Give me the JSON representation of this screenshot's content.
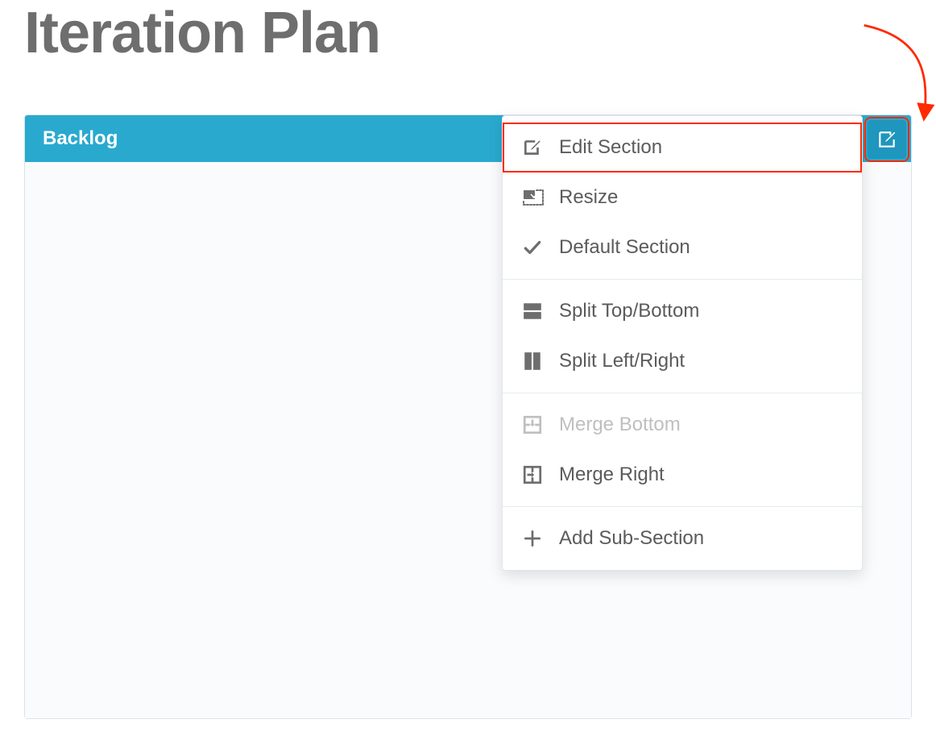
{
  "page": {
    "title": "Iteration Plan"
  },
  "panel": {
    "title": "Backlog"
  },
  "menu": {
    "groups": [
      {
        "items": [
          {
            "id": "edit-section",
            "label": "Edit Section",
            "icon": "edit-icon",
            "highlighted": true,
            "disabled": false
          },
          {
            "id": "resize",
            "label": "Resize",
            "icon": "resize-icon",
            "highlighted": false,
            "disabled": false
          },
          {
            "id": "default-section",
            "label": "Default Section",
            "icon": "check-icon",
            "highlighted": false,
            "disabled": false
          }
        ]
      },
      {
        "items": [
          {
            "id": "split-top-bottom",
            "label": "Split Top/Bottom",
            "icon": "split-horizontal-icon",
            "highlighted": false,
            "disabled": false
          },
          {
            "id": "split-left-right",
            "label": "Split Left/Right",
            "icon": "split-vertical-icon",
            "highlighted": false,
            "disabled": false
          }
        ]
      },
      {
        "items": [
          {
            "id": "merge-bottom",
            "label": "Merge Bottom",
            "icon": "merge-bottom-icon",
            "highlighted": false,
            "disabled": true
          },
          {
            "id": "merge-right",
            "label": "Merge Right",
            "icon": "merge-right-icon",
            "highlighted": false,
            "disabled": false
          }
        ]
      },
      {
        "items": [
          {
            "id": "add-sub-section",
            "label": "Add Sub-Section",
            "icon": "plus-icon",
            "highlighted": false,
            "disabled": false
          }
        ]
      }
    ]
  },
  "colors": {
    "headerTeal": "#2aa9cf",
    "highlightRed": "#ff2a00",
    "iconGray": "#6e6e6e",
    "disabledGray": "#bfbfbf"
  }
}
